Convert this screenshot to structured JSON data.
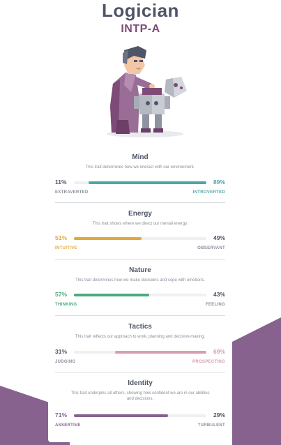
{
  "header": {
    "title": "Logician",
    "subtitle": "INTP-A"
  },
  "colors": {
    "mind": "#4aa8a5",
    "energy": "#e0a93c",
    "nature": "#4da97e",
    "tactics": "#d89cb3",
    "identity": "#88628f",
    "neutral": "#4d5567",
    "muted": "#888f9a",
    "background_shape": "#88628f"
  },
  "traits": [
    {
      "name": "Mind",
      "description": "This trait determines how we interact with our environment.",
      "left": {
        "percent": "11%",
        "label": "EXTRAVERTED"
      },
      "right": {
        "percent": "89%",
        "label": "INTROVERTED"
      },
      "dominant": "right",
      "value_fraction": 0.89
    },
    {
      "name": "Energy",
      "description": "This trait shows where we direct our mental energy.",
      "left": {
        "percent": "51%",
        "label": "INTUITIVE"
      },
      "right": {
        "percent": "49%",
        "label": "OBSERVANT"
      },
      "dominant": "left",
      "value_fraction": 0.51
    },
    {
      "name": "Nature",
      "description": "This trait determines how we make decisions and cope with emotions.",
      "left": {
        "percent": "57%",
        "label": "THINKING"
      },
      "right": {
        "percent": "43%",
        "label": "FEELING"
      },
      "dominant": "left",
      "value_fraction": 0.57
    },
    {
      "name": "Tactics",
      "description": "This trait reflects our approach to work, planning and decision-making.",
      "left": {
        "percent": "31%",
        "label": "JUDGING"
      },
      "right": {
        "percent": "69%",
        "label": "PROSPECTING"
      },
      "dominant": "right",
      "value_fraction": 0.69
    },
    {
      "name": "Identity",
      "description": "This trait underpins all others, showing how confident we are in our abilities and decisions.",
      "left": {
        "percent": "71%",
        "label": "ASSERTIVE"
      },
      "right": {
        "percent": "29%",
        "label": "TURBULENT"
      },
      "dominant": "left",
      "value_fraction": 0.71
    }
  ],
  "illustration": {
    "icon": "logician-scientist-with-robot-illustration"
  }
}
